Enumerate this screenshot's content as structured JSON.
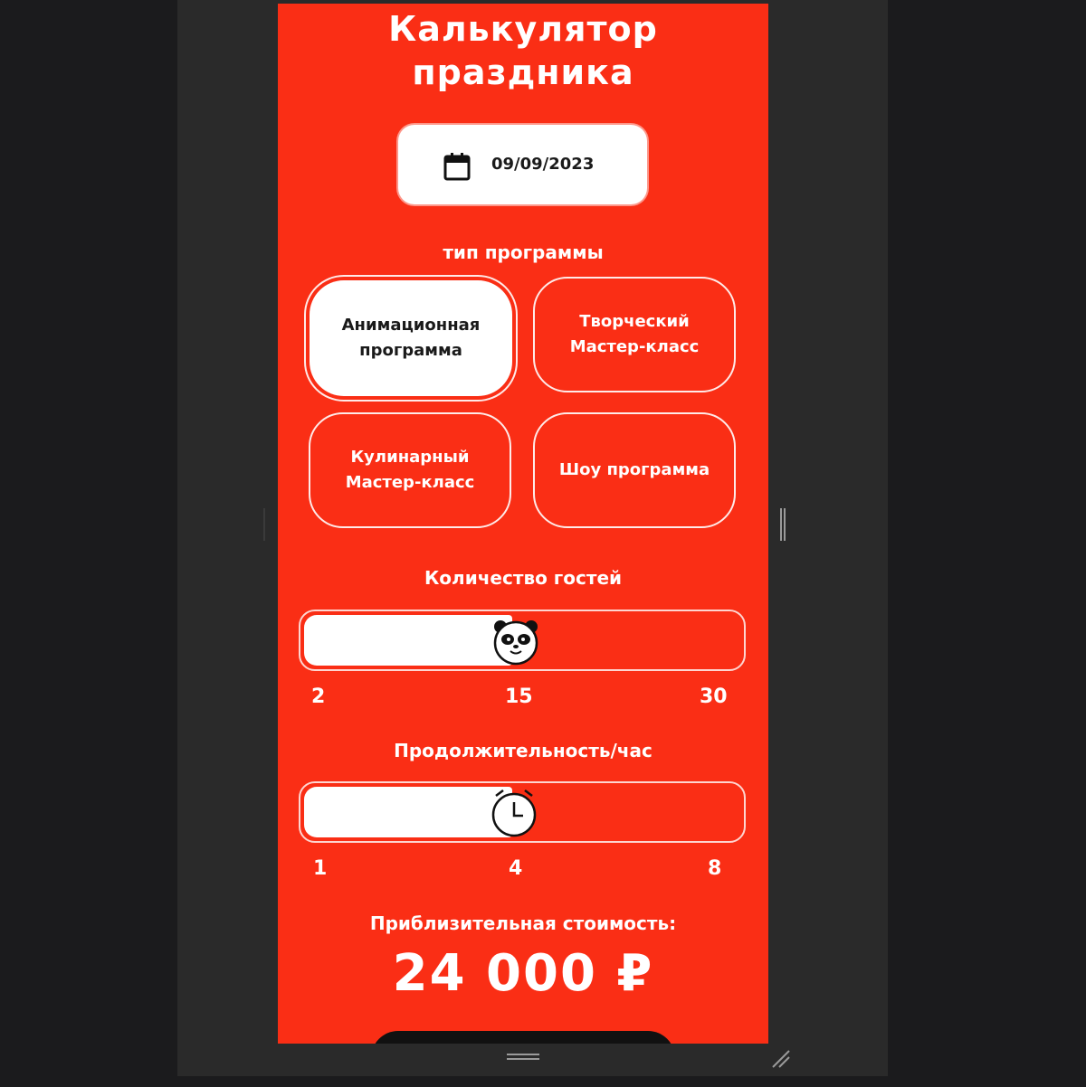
{
  "title_line1": "Калькулятор",
  "title_line2": "праздника",
  "date": {
    "value": "09/09/2023",
    "icon": "calendar-icon"
  },
  "program": {
    "label": "тип программы",
    "options": [
      {
        "label": "Анимационная\nпрограмма",
        "selected": true
      },
      {
        "label": "Творческий\nМастер-класс",
        "selected": false
      },
      {
        "label": "Кулинарный\nМастер-класс",
        "selected": false
      },
      {
        "label": "Шоу программа",
        "selected": false
      }
    ]
  },
  "guests": {
    "label": "Количество гостей",
    "min": "2",
    "mid": "15",
    "max": "30",
    "value": 15,
    "thumb_icon": "panda-icon"
  },
  "duration": {
    "label": "Продолжительность/час",
    "min": "1",
    "mid": "4",
    "max": "8",
    "value": 4,
    "thumb_icon": "alarm-clock-icon"
  },
  "cost": {
    "label": "Приблизительная стоимость:",
    "value": "24 000 ₽"
  },
  "colors": {
    "accent": "#fa2e15",
    "surface": "#ffffff",
    "frame": "#2a2a2a"
  }
}
